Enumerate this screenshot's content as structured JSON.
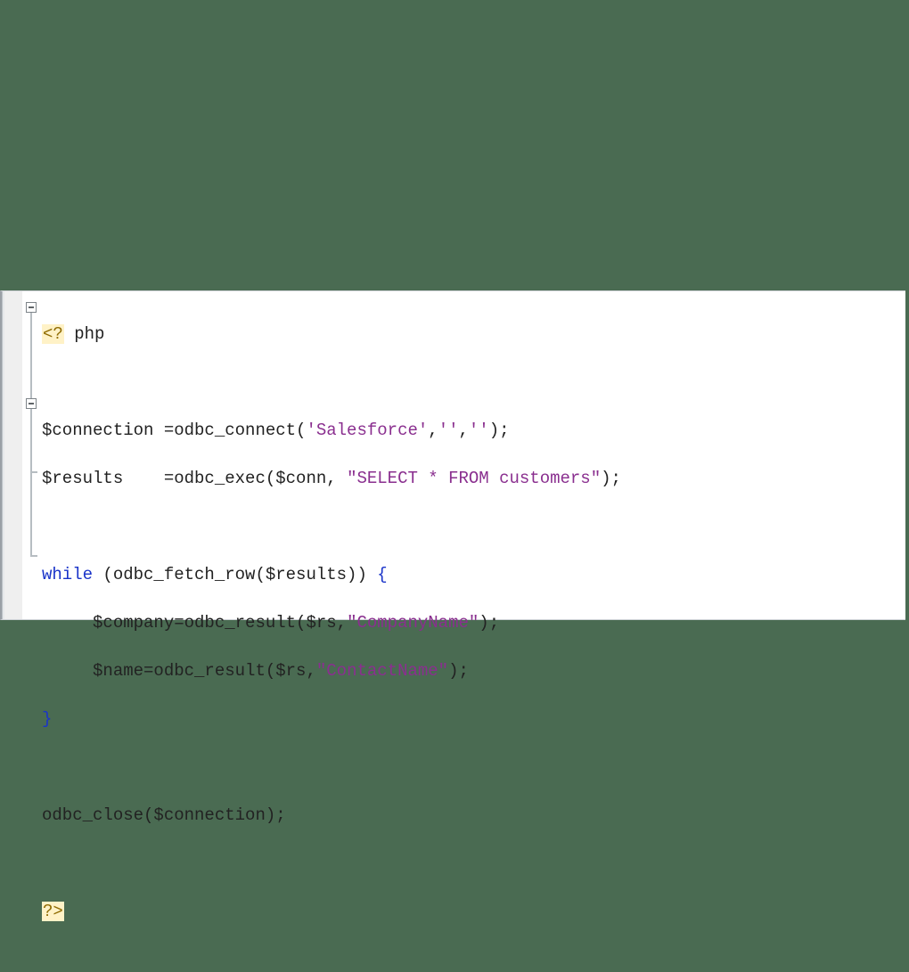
{
  "code": {
    "open_tag_lt": "<",
    "open_tag_q": "?",
    "php_word": " php",
    "l2_a": "$connection =odbc_connect(",
    "l2_s1": "'Salesforce'",
    "l2_b": ",",
    "l2_s2": "''",
    "l2_c": ",",
    "l2_s3": "''",
    "l2_d": ");",
    "l3_a": "$results    =odbc_exec($conn, ",
    "l3_s1": "\"SELECT * FROM customers\"",
    "l3_b": ");",
    "l5_kw": "while",
    "l5_a": " (odbc_fetch_row($results)) ",
    "l5_brace": "{",
    "l6_a": "     $company=odbc_result($rs,",
    "l6_s1": "\"CompanyName\"",
    "l6_b": ");",
    "l7_a": "     $name=odbc_result($rs,",
    "l7_s1": "\"ContactName\"",
    "l7_b": ");",
    "l8_brace": "}",
    "l10": "odbc_close($connection);",
    "close_tag_q": "?",
    "close_tag_gt": ">"
  }
}
